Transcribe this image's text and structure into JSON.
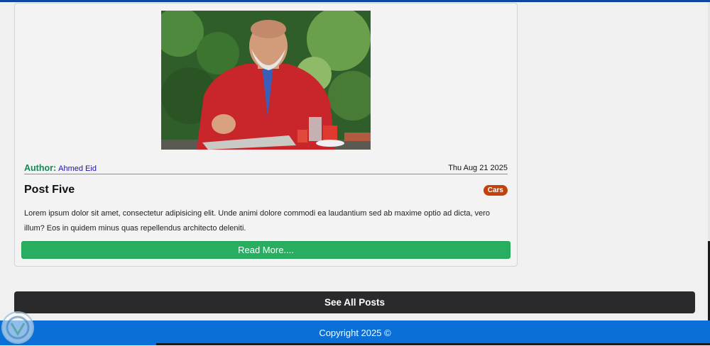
{
  "post": {
    "author_label": "Author:",
    "author_name": "Ahmed Eid",
    "date": "Thu Aug 21 2025",
    "title": "Post Five",
    "category": "Cars",
    "excerpt": "Lorem ipsum dolor sit amet, consectetur adipisicing elit. Unde animi dolore commodi ea laudantium sed ab maxime optio ad dicta, vero illum? Eos in quidem minus quas repellendus architecto deleniti.",
    "read_more_label": "Read More...."
  },
  "see_all_label": "See All Posts",
  "footer": {
    "copyright": "Copyright 2025 ©"
  },
  "colors": {
    "author_label": "#198754",
    "author_name": "#1a12a8",
    "badge": "#c2410c",
    "read_more": "#27ae60",
    "see_all": "#2a2a2c",
    "footer": "#0a6fd6"
  },
  "icons": {
    "watermark": "logo-watermark-icon"
  }
}
